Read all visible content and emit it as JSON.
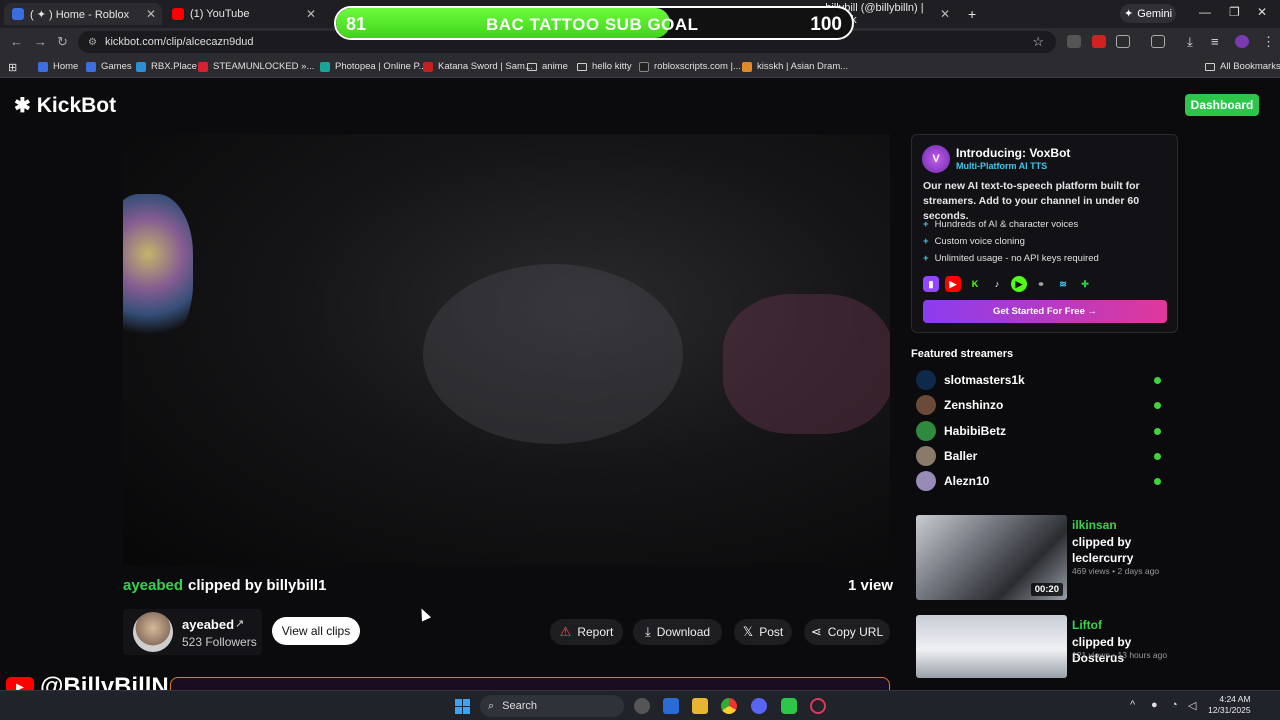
{
  "browser": {
    "tabs": [
      {
        "label": "( ✦ ) Home - Roblox",
        "color": "#3b6fe0"
      },
      {
        "label": "(1) YouTube",
        "color": "#ff0000"
      },
      {
        "label": "billybill (@billybilln) | TikTok",
        "color": "#111111"
      }
    ],
    "gemini_label": "Gemini",
    "url": "kickbot.com/clip/alcecazn9dud",
    "bookmarks": [
      {
        "label": "Home",
        "color": "#3b6fe0"
      },
      {
        "label": "Games",
        "color": "#3b6fe0"
      },
      {
        "label": "RBX.Place",
        "color": "#2a8fd6"
      },
      {
        "label": "STEAMUNLOCKED »...",
        "color": "#d6212f"
      },
      {
        "label": "Photopea | Online P...",
        "color": "#18a498"
      },
      {
        "label": "Katana Sword | Sam...",
        "color": "#c42020"
      },
      {
        "label": "anime",
        "folder": true
      },
      {
        "label": "hello kitty",
        "folder": true
      },
      {
        "label": "robloxscripts.com |...",
        "color": "#222222"
      },
      {
        "label": "kisskh | Asian Dram...",
        "color": "#e08a2a"
      }
    ],
    "all_bookmarks": "All Bookmarks"
  },
  "sub_goal": {
    "current": "81",
    "title": "BAC TATTOO SUB GOAL",
    "target": "100",
    "progress": 0.81
  },
  "site": {
    "logo": "KickBot",
    "dashboard_label": "Dashboard"
  },
  "clip": {
    "streamer": "ayeabed",
    "clipped_by_text": "clipped by billybill1",
    "views": "1 view",
    "author": {
      "name": "ayeabed",
      "followers": "523 Followers"
    },
    "view_all_label": "View all clips",
    "actions": {
      "report": "Report",
      "download": "Download",
      "post": "Post",
      "copy_url": "Copy URL"
    }
  },
  "promo": {
    "title": "Introducing: VoxBot",
    "subtitle": "Multi-Platform AI TTS",
    "description": "Our new AI text-to-speech platform built for streamers. Add to your channel in under 60 seconds.",
    "features": [
      "Hundreds of AI & character voices",
      "Custom voice cloning",
      "Unlimited usage - no API keys required"
    ],
    "cta": "Get Started For Free →"
  },
  "featured": {
    "heading": "Featured streamers",
    "streamers": [
      "slotmasters1k",
      "Zenshinzo",
      "HabibiBetz",
      "Baller",
      "Alezn10"
    ]
  },
  "related": [
    {
      "streamer": "ilkinsan",
      "clipped_by": "clipped by leclercurry",
      "meta": "469 views • 2 days ago",
      "duration": "00:20"
    },
    {
      "streamer": "Liftof",
      "clipped_by": "clipped by Dosterus",
      "meta": "121 views • 13 hours ago",
      "duration": ""
    }
  ],
  "overlay": {
    "handle": "@BillyBillN"
  },
  "taskbar": {
    "search_placeholder": "Search",
    "time": "4:24 AM",
    "date": "12/31/2025"
  }
}
